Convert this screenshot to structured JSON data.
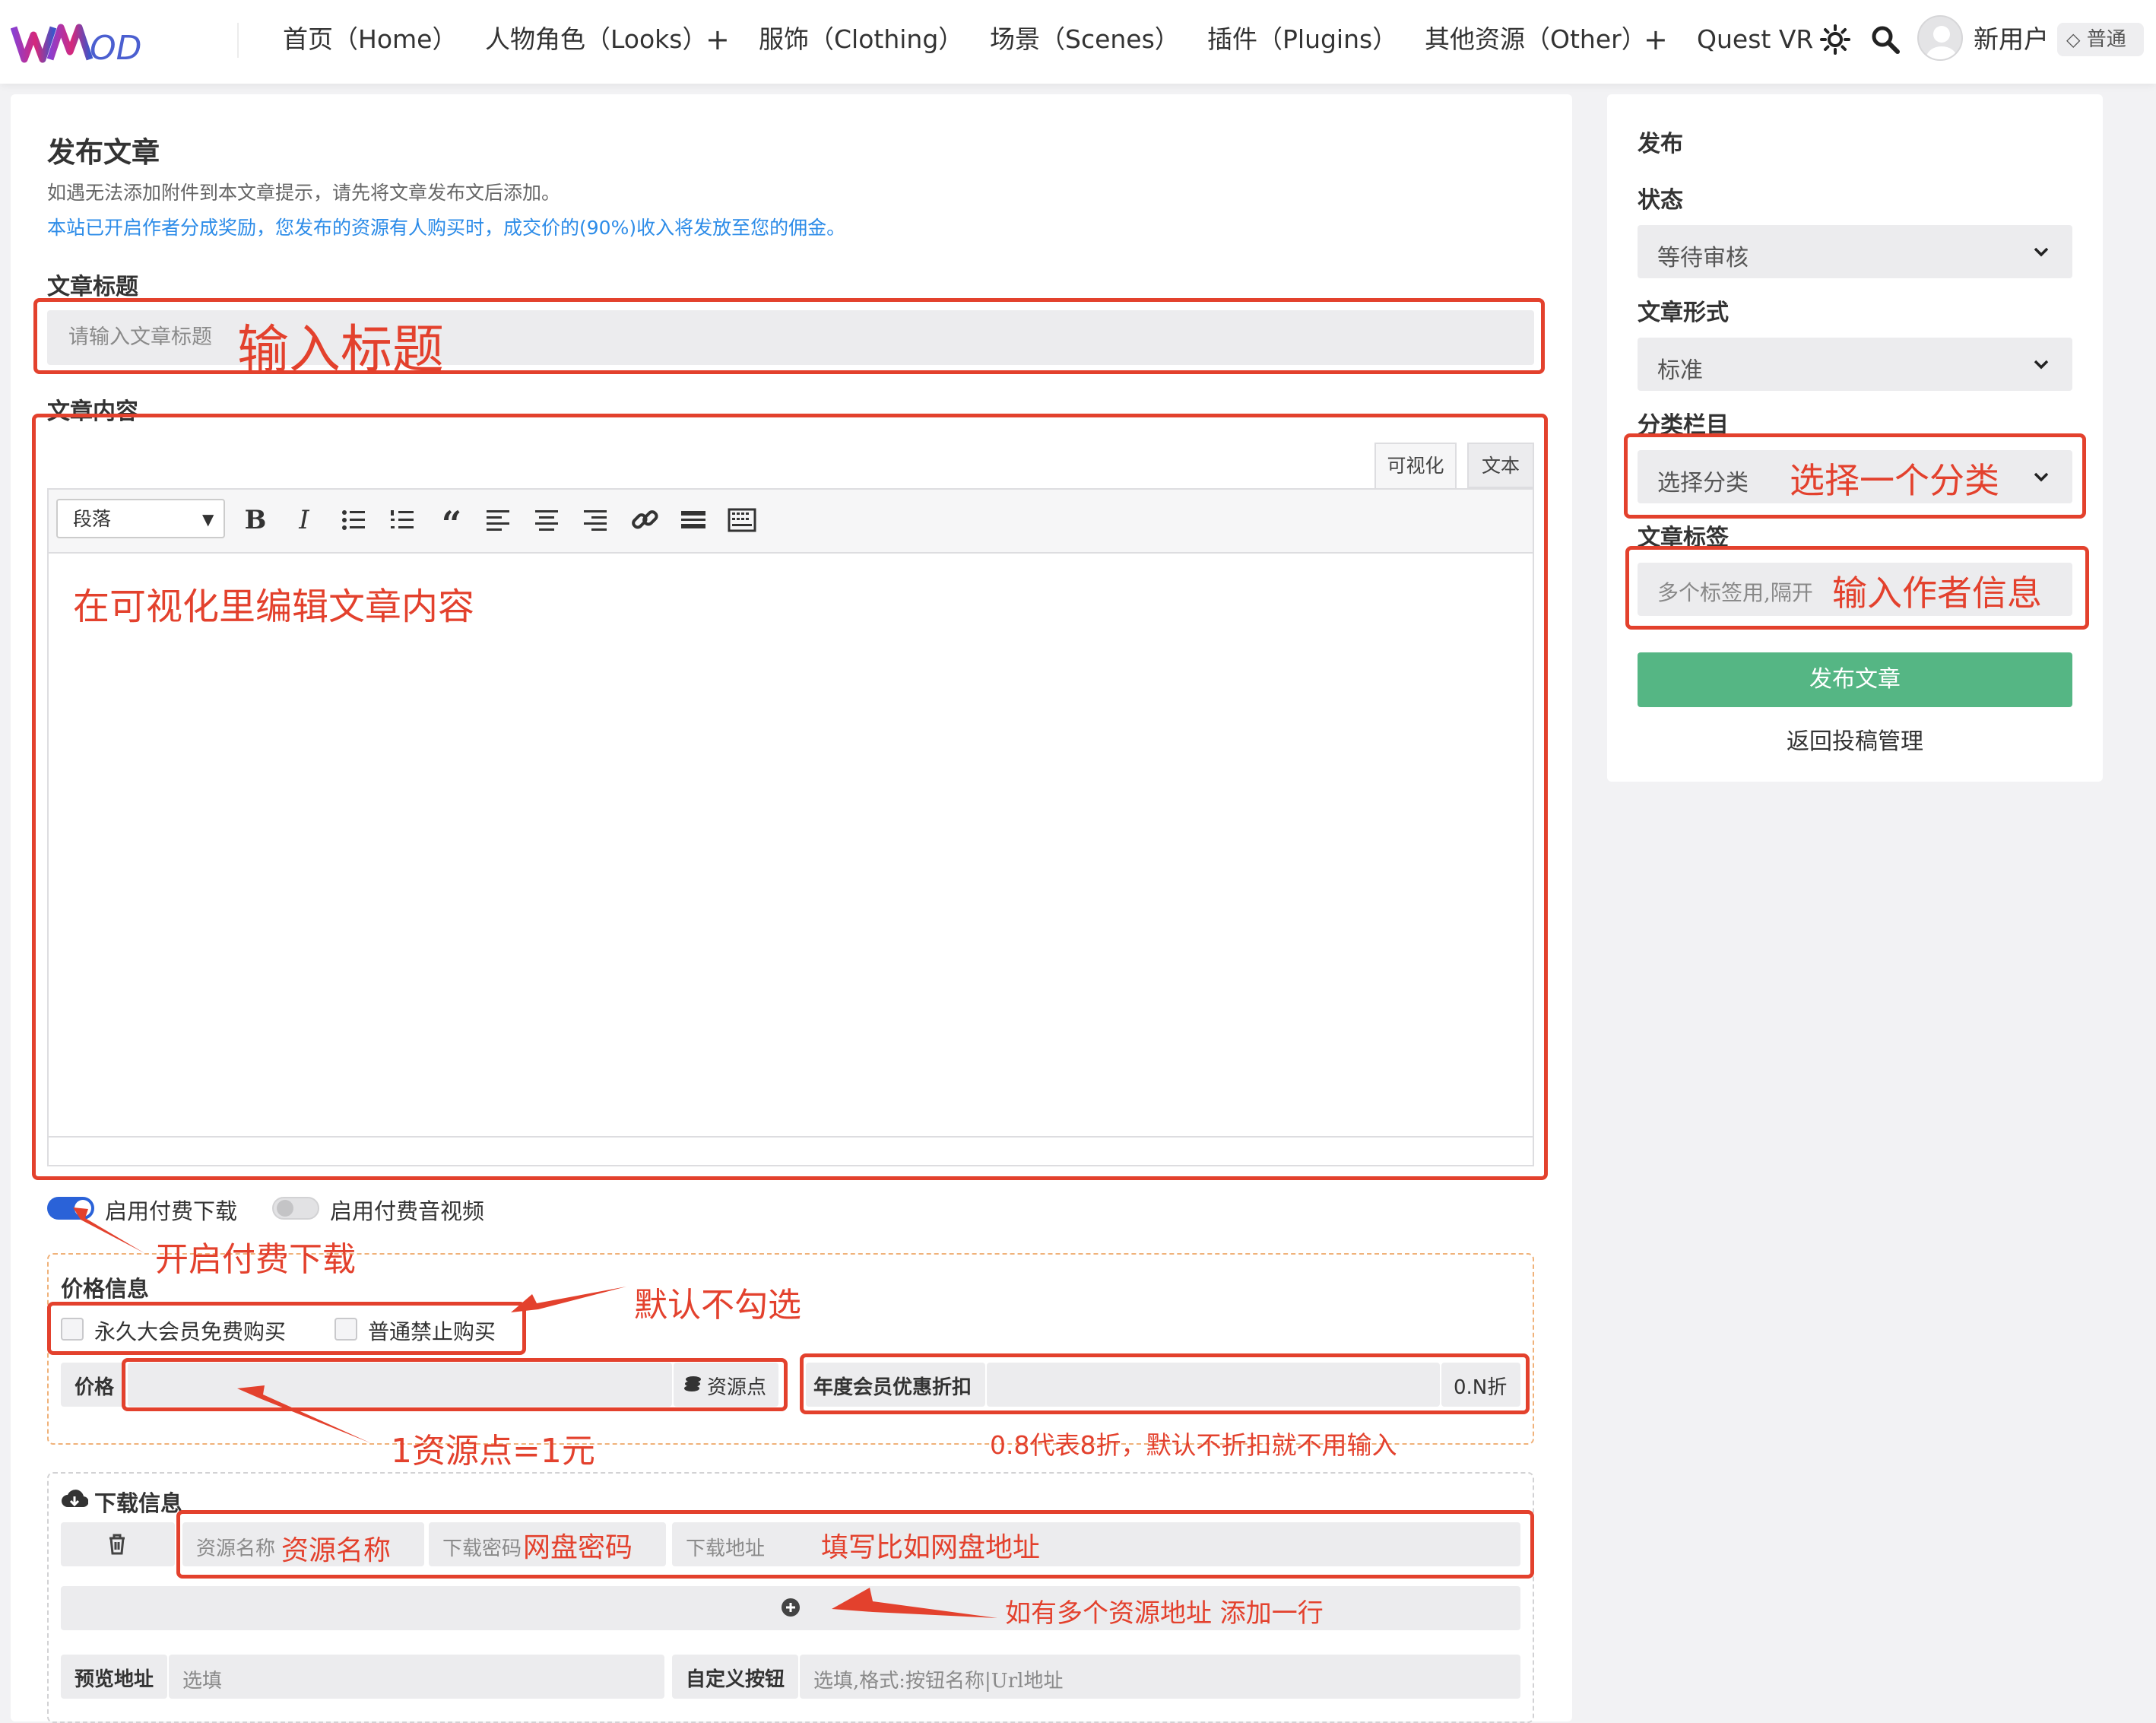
{
  "header": {
    "logo_text": "WMOD",
    "nav": [
      {
        "label": "首页（Home）"
      },
      {
        "label": "人物角色（Looks）"
      },
      {
        "label": "服饰（Clothing）"
      },
      {
        "label": "场景（Scenes）"
      },
      {
        "label": "插件（Plugins）"
      },
      {
        "label": "其他资源（Other）"
      },
      {
        "label": "Quest VR"
      }
    ],
    "plus": "+",
    "user_name": "新用户",
    "badge": "普通"
  },
  "form": {
    "title": "发布文章",
    "note1": "如遇无法添加附件到本文章提示，请先将文章发布文后添加。",
    "note2": "本站已开启作者分成奖励，您发布的资源有人购买时，成交价的(90%)收入将发放至您的佣金。",
    "title_label": "文章标题",
    "title_placeholder": "请输入文章标题",
    "content_label": "文章内容",
    "editor_tabs": [
      "可视化",
      "文本"
    ],
    "paragraph_select": "段落",
    "toggle_paid_download": "启用付费下载",
    "toggle_paid_av": "启用付费音视频",
    "price_section_label": "价格信息",
    "checkbox_vip_free": "永久大会员免费购买",
    "checkbox_normal_forbid": "普通禁止购买",
    "price_label": "价格",
    "price_unit": "资源点",
    "discount_label": "年度会员优惠折扣",
    "discount_unit": "0.N折",
    "download_section_label": "下载信息",
    "res_name_ph": "资源名称",
    "res_pwd_ph": "下载密码",
    "res_url_ph": "下载地址",
    "preview_label": "预览地址",
    "preview_ph": "选填",
    "custom_btn_label": "自定义按钮",
    "custom_btn_ph": "选填,格式:按钮名称|Url地址"
  },
  "sidebar": {
    "title": "发布",
    "status_label": "状态",
    "status_value": "等待审核",
    "format_label": "文章形式",
    "format_value": "标准",
    "category_label": "分类栏目",
    "category_value": "选择分类",
    "tags_label": "文章标签",
    "tags_placeholder": "多个标签用,隔开",
    "publish_button": "发布文章",
    "back_link": "返回投稿管理"
  },
  "annotations": {
    "title": "输入标题",
    "content": "在可视化里编辑文章内容",
    "category": "选择一个分类",
    "tags": "输入作者信息",
    "paid_download": "开启付费下载",
    "checkbox_default": "默认不勾选",
    "price_rate": "1资源点=1元",
    "discount_note": "0.8代表8折，默认不折扣就不用输入",
    "res_name": "资源名称",
    "res_pwd": "网盘密码",
    "res_url": "填写比如网盘地址",
    "add_row": "如有多个资源地址 添加一行"
  },
  "colors": {
    "annotation_red": "#e3412d",
    "accent_blue": "#2d8ce8",
    "toggle_on": "#2a62d8",
    "publish_green": "#55b684"
  }
}
